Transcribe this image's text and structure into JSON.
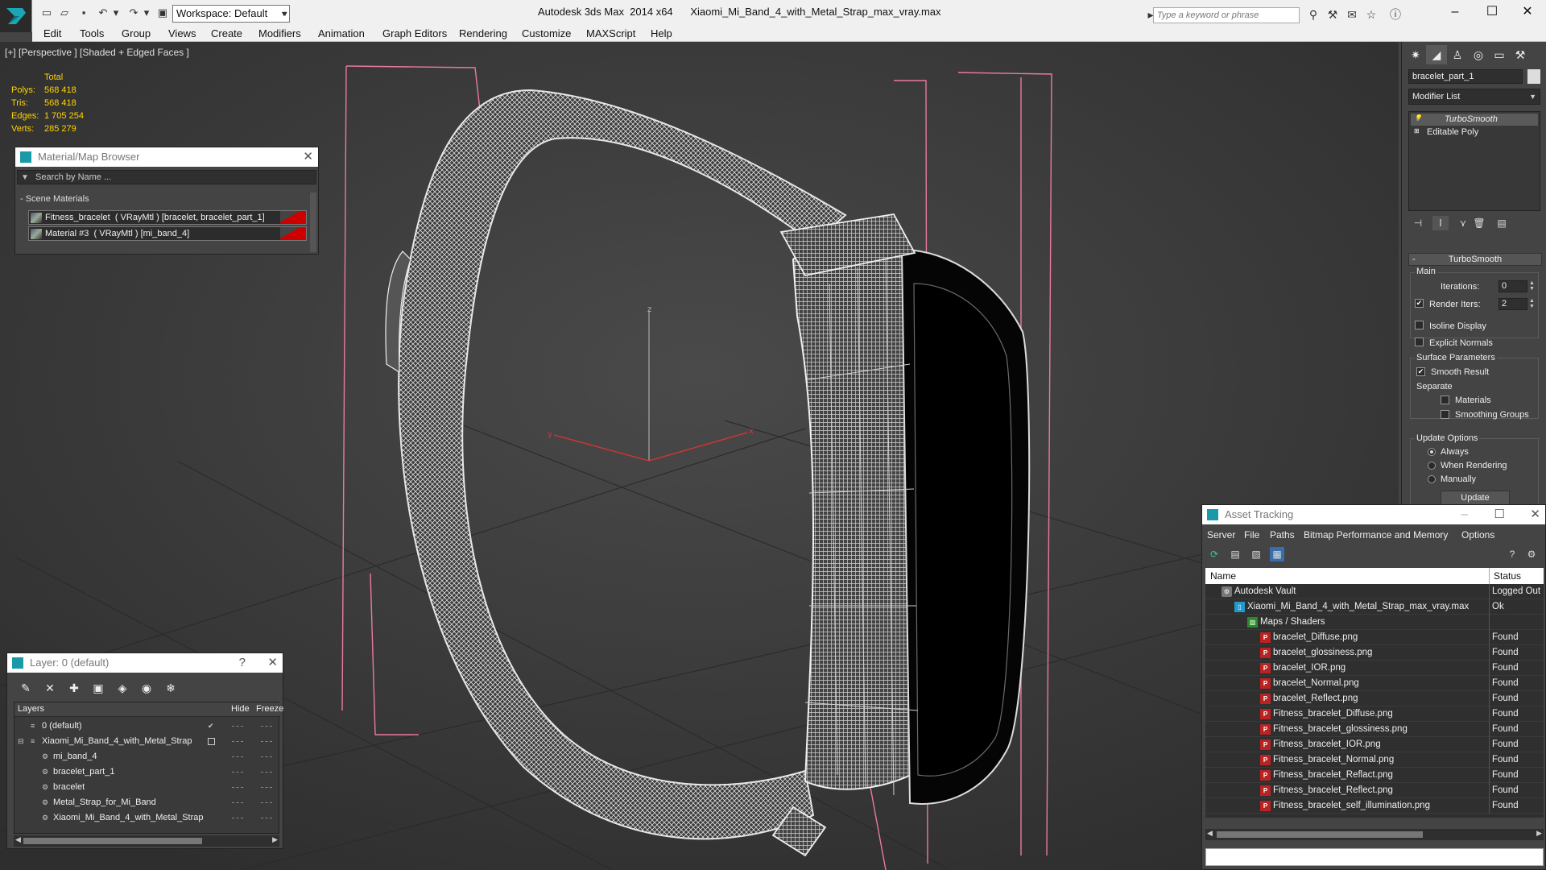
{
  "app": {
    "title": "Autodesk 3ds Max  2014 x64      Xiaomi_Mi_Band_4_with_Metal_Strap_max_vray.max",
    "workspace": "Workspace: Default",
    "search_placeholder": "Type a keyword or phrase"
  },
  "menu": [
    "Edit",
    "Tools",
    "Group",
    "Views",
    "Create",
    "Modifiers",
    "Animation",
    "Graph Editors",
    "Rendering",
    "Customize",
    "MAXScript",
    "Help"
  ],
  "viewport": {
    "label": "[+] [Perspective ] [Shaded + Edged Faces ]",
    "stats": {
      "header": "Total",
      "rows": [
        {
          "key": "Polys:",
          "value": "568 418"
        },
        {
          "key": "Tris:",
          "value": "568 418"
        },
        {
          "key": "Edges:",
          "value": "1 705 254"
        },
        {
          "key": "Verts:",
          "value": "285 279"
        }
      ]
    },
    "axes": {
      "x": "x",
      "y": "y",
      "z": "z"
    }
  },
  "material_browser": {
    "title": "Material/Map Browser",
    "search_placeholder": "Search by Name ...",
    "section": "- Scene Materials",
    "materials": [
      "Fitness_bracelet  ( VRayMtl ) [bracelet, bracelet_part_1]",
      "Material #3  ( VRayMtl ) [mi_band_4]"
    ]
  },
  "layers": {
    "title": "Layer: 0 (default)",
    "help": "?",
    "columns": {
      "layers": "Layers",
      "hide": "Hide",
      "freeze": "Freeze"
    },
    "rows": [
      {
        "name": "0 (default)",
        "level": 0,
        "current": true
      },
      {
        "name": "Xiaomi_Mi_Band_4_with_Metal_Strap",
        "level": 0,
        "current": false
      },
      {
        "name": "mi_band_4",
        "level": 1,
        "current": false
      },
      {
        "name": "bracelet_part_1",
        "level": 1,
        "current": false
      },
      {
        "name": "bracelet",
        "level": 1,
        "current": false
      },
      {
        "name": "Metal_Strap_for_Mi_Band",
        "level": 1,
        "current": false
      },
      {
        "name": "Xiaomi_Mi_Band_4_with_Metal_Strap",
        "level": 1,
        "current": false
      }
    ]
  },
  "command_panel": {
    "object_name": "bracelet_part_1",
    "modifier_list": "Modifier List",
    "stack": [
      "TurboSmooth",
      "Editable Poly"
    ],
    "turbosmooth": {
      "title": "TurboSmooth",
      "main_group": "Main",
      "iterations_label": "Iterations:",
      "iterations": "0",
      "render_iters_label": "Render Iters:",
      "render_iters": "2",
      "render_iters_checked": true,
      "isoline": "Isoline Display",
      "explicit": "Explicit Normals",
      "surface_group": "Surface Parameters",
      "smooth_result": "Smooth Result",
      "separate": "Separate",
      "materials": "Materials",
      "smoothing_groups": "Smoothing Groups",
      "update_group": "Update Options",
      "always": "Always",
      "when_rendering": "When Rendering",
      "manually": "Manually",
      "update_button": "Update"
    }
  },
  "asset_tracking": {
    "title": "Asset Tracking",
    "menu": [
      "Server",
      "File",
      "Paths",
      "Bitmap Performance and Memory",
      "Options"
    ],
    "columns": {
      "name": "Name",
      "status": "Status"
    },
    "rows": [
      {
        "name": "Autodesk Vault",
        "status": "Logged Out",
        "level": 0,
        "icon": "vault-icon"
      },
      {
        "name": "Xiaomi_Mi_Band_4_with_Metal_Strap_max_vray.max",
        "status": "Ok",
        "level": 1,
        "icon": "max-file-icon"
      },
      {
        "name": "Maps / Shaders",
        "status": "",
        "level": 2,
        "icon": "maps-icon"
      },
      {
        "name": "bracelet_Diffuse.png",
        "status": "Found",
        "level": 3,
        "icon": "png-icon"
      },
      {
        "name": "bracelet_glossiness.png",
        "status": "Found",
        "level": 3,
        "icon": "png-icon"
      },
      {
        "name": "bracelet_IOR.png",
        "status": "Found",
        "level": 3,
        "icon": "png-icon"
      },
      {
        "name": "bracelet_Normal.png",
        "status": "Found",
        "level": 3,
        "icon": "png-icon"
      },
      {
        "name": "bracelet_Reflect.png",
        "status": "Found",
        "level": 3,
        "icon": "png-icon"
      },
      {
        "name": "Fitness_bracelet_Diffuse.png",
        "status": "Found",
        "level": 3,
        "icon": "png-icon"
      },
      {
        "name": "Fitness_bracelet_glossiness.png",
        "status": "Found",
        "level": 3,
        "icon": "png-icon"
      },
      {
        "name": "Fitness_bracelet_IOR.png",
        "status": "Found",
        "level": 3,
        "icon": "png-icon"
      },
      {
        "name": "Fitness_bracelet_Normal.png",
        "status": "Found",
        "level": 3,
        "icon": "png-icon"
      },
      {
        "name": "Fitness_bracelet_Reflact.png",
        "status": "Found",
        "level": 3,
        "icon": "png-icon"
      },
      {
        "name": "Fitness_bracelet_Reflect.png",
        "status": "Found",
        "level": 3,
        "icon": "png-icon"
      },
      {
        "name": "Fitness_bracelet_self_illumination.png",
        "status": "Found",
        "level": 3,
        "icon": "png-icon"
      }
    ]
  },
  "colors": {
    "stats_yellow": "#ffd400",
    "selection_pink": "#e87aa0",
    "wire": "#e8e8e8"
  }
}
